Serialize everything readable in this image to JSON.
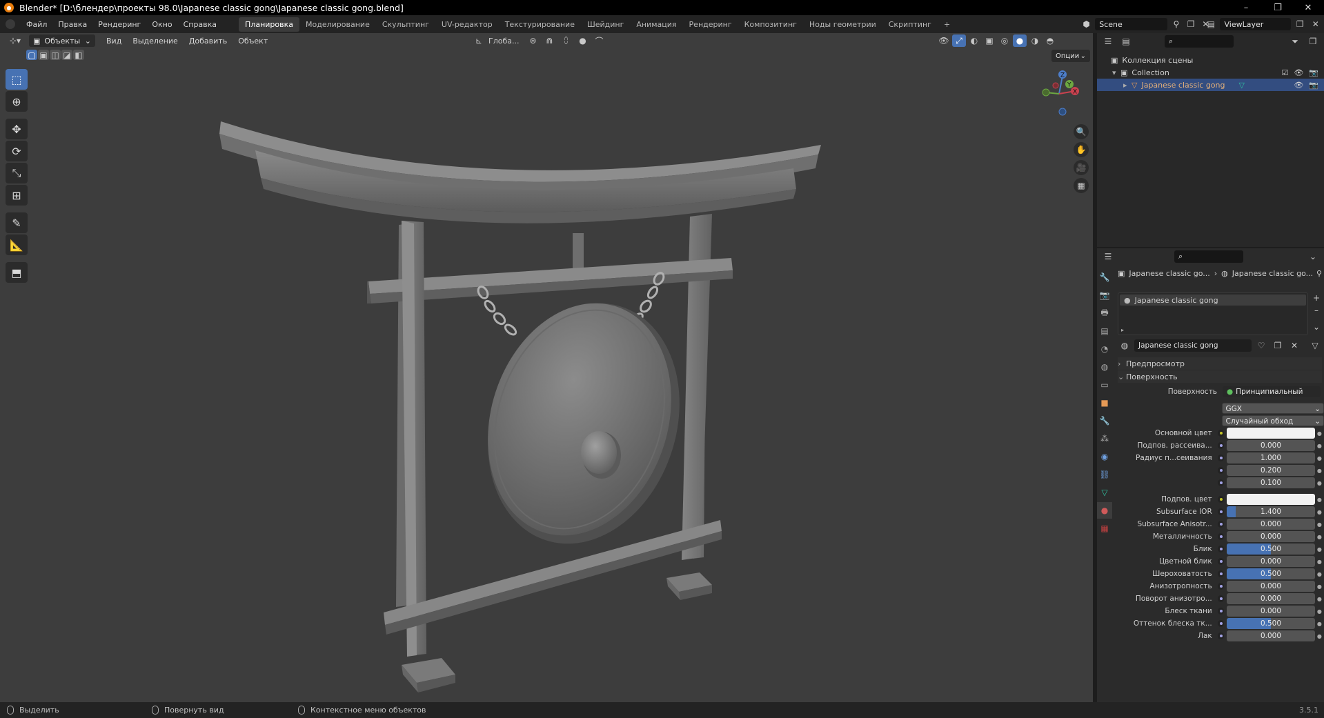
{
  "window": {
    "title": "Blender* [D:\\блендер\\проекты 98.0\\Japanese classic gong\\Japanese classic gong.blend]",
    "minimize": "–",
    "maximize": "❐",
    "close": "✕"
  },
  "menu": [
    "Файл",
    "Правка",
    "Рендеринг",
    "Окно",
    "Справка"
  ],
  "workspaces": [
    "Планировка",
    "Моделирование",
    "Скульптинг",
    "UV-редактор",
    "Текстурирование",
    "Шейдинг",
    "Анимация",
    "Рендеринг",
    "Композитинг",
    "Ноды геометрии",
    "Скриптинг"
  ],
  "workspace_add": "+",
  "scene_name": "Scene",
  "view_layer": "ViewLayer",
  "viewport": {
    "mode": "Объекты",
    "menus": [
      "Вид",
      "Выделение",
      "Добавить",
      "Объект"
    ],
    "transform_orientation": "Глоба...",
    "options": "Опции",
    "gizmo": {
      "z": "Z",
      "y": "Y",
      "x": "X"
    }
  },
  "outliner": {
    "scene_collection": "Коллекция сцены",
    "collection": "Collection",
    "object": "Japanese classic gong"
  },
  "properties": {
    "breadcrumb_object": "Japanese classic go...",
    "breadcrumb_material": "Japanese classic go...",
    "slot": "Japanese classic gong",
    "material_name": "Japanese classic gong",
    "panel_preview": "Предпросмотр",
    "panel_surface": "Поверхность",
    "surface_label": "Поверхность",
    "surface_shader": "Принципиальный BSDF",
    "distribution": "GGX",
    "subsurface_method": "Случайный обход",
    "rows": [
      {
        "label": "Основной цвет",
        "type": "color",
        "color": "#f2f2f2",
        "socket": "yellow"
      },
      {
        "label": "Подпов. рассеива...",
        "value": "0.000",
        "fill": 0
      },
      {
        "label": "Радиус п...сеивания",
        "value": "1.000",
        "fill": 0
      },
      {
        "label": "",
        "value": "0.200",
        "fill": 0
      },
      {
        "label": "",
        "value": "0.100",
        "fill": 0
      },
      {
        "label": "Подпов. цвет",
        "type": "color",
        "color": "#f2f2f2",
        "socket": "yellow"
      },
      {
        "label": "Subsurface IOR",
        "value": "1.400",
        "fill": 0.1
      },
      {
        "label": "Subsurface Anisotr...",
        "value": "0.000",
        "fill": 0
      },
      {
        "label": "Металличность",
        "value": "0.000",
        "fill": 0
      },
      {
        "label": "Блик",
        "value": "0.500",
        "fill": 0.5
      },
      {
        "label": "Цветной блик",
        "value": "0.000",
        "fill": 0
      },
      {
        "label": "Шероховатость",
        "value": "0.500",
        "fill": 0.5
      },
      {
        "label": "Анизотропность",
        "value": "0.000",
        "fill": 0
      },
      {
        "label": "Поворот анизотро...",
        "value": "0.000",
        "fill": 0
      },
      {
        "label": "Блеск ткани",
        "value": "0.000",
        "fill": 0
      },
      {
        "label": "Оттенок блеска тк...",
        "value": "0.500",
        "fill": 0.5
      },
      {
        "label": "Лак",
        "value": "0.000",
        "fill": 0
      }
    ]
  },
  "status": {
    "select": "Выделить",
    "rotate": "Повернуть вид",
    "context": "Контекстное меню объектов",
    "version": "3.5.1"
  },
  "colors": {
    "accent": "#4772b3",
    "selected_row": "#334d80",
    "viewport_bg": "#3d3d3d"
  }
}
